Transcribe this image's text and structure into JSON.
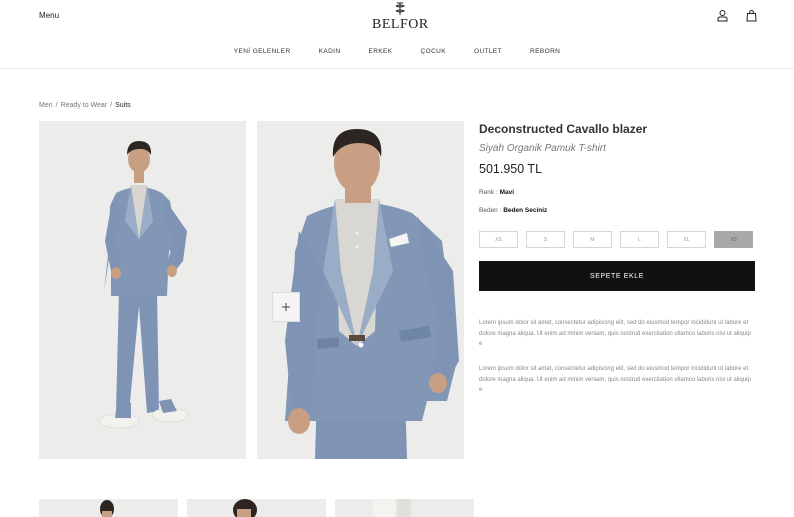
{
  "header": {
    "menu_label": "Menu",
    "brand": "BELFOR",
    "nav": [
      "YENİ GELENLER",
      "KADIN",
      "ERKEK",
      "ÇOCUK",
      "OUTLET",
      "REBORN"
    ]
  },
  "icons": {
    "account": "user-icon",
    "bag": "shopping-bag-icon",
    "zoom": "plus-icon"
  },
  "breadcrumb": {
    "items": [
      "Men",
      "Ready to Wear"
    ],
    "current": "Suits",
    "separator": "/"
  },
  "product": {
    "title": "Deconstructed Cavallo blazer",
    "subtitle": "Siyah Organik Pamuk T-shirt",
    "price": "501.950 TL",
    "color_label": "Renk :",
    "color_value": "Mavi",
    "size_label": "Beden :",
    "size_value": "Beden Seciniz",
    "sizes": [
      "XS",
      "S",
      "M",
      "L",
      "XL",
      "XS"
    ],
    "selected_size_index": 5,
    "add_to_cart": "SEPETE EKLE",
    "description": [
      "Lorem ipsum dolor sit amet, consectetur adipiscing elit, sed do eiusmod tempor incididunt ut labore et dolore magna aliqua. Ut enim ad minim veniam, quis nostrud exercitation ullamco laboris nisi ut aliquip e",
      "Lorem ipsum dolor sit amet, consectetur adipiscing elit, sed do eiusmod tempor incididunt ut labore et dolore magna aliqua. Ut enim ad minim veniam, quis nostrud exercitation ullamco laboris nisi ut aliquip e"
    ]
  },
  "colors": {
    "suit": "#7f93b4",
    "photo_bg": "#ececea",
    "button_bg": "#111111",
    "selected_size": "#a9a9a9"
  }
}
